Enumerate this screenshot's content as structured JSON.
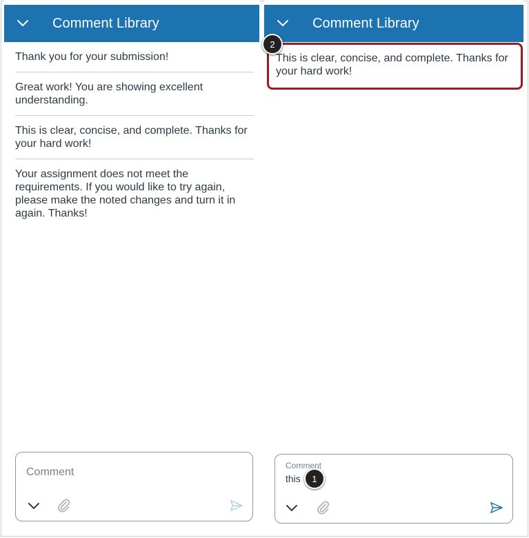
{
  "left_panel": {
    "header_title": "Comment Library",
    "items": [
      "Thank you for your submission!",
      "Great work! You are showing excellent understanding.",
      "This is clear, concise, and complete. Thanks for your hard work!",
      "Your assignment does not meet the requirements. If you would like to try again, please make the noted changes and turn it in again. Thanks!"
    ],
    "composer": {
      "placeholder": "Comment"
    }
  },
  "right_panel": {
    "header_title": "Comment Library",
    "suggestion": "This is clear, concise, and complete. Thanks for your hard work!",
    "composer": {
      "label": "Comment",
      "value": "this"
    }
  },
  "badges": {
    "one": "1",
    "two": "2"
  },
  "colors": {
    "header": "#1d72b0",
    "highlight": "#9b1a24",
    "send": "#1d72b0",
    "send_disabled": "#a9d4e3"
  },
  "icons": [
    "chevron-down-icon",
    "paperclip-icon",
    "send-icon"
  ]
}
